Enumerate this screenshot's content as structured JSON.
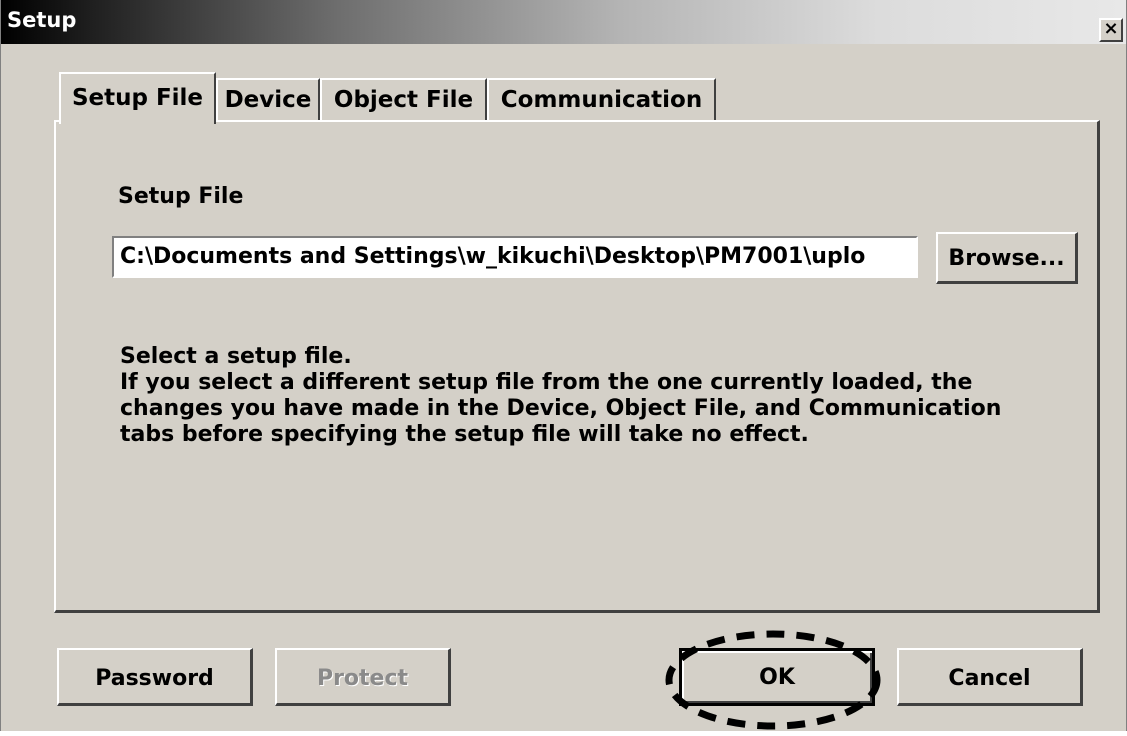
{
  "window": {
    "title": "Setup",
    "close_label": "×"
  },
  "tabs": [
    {
      "label": "Setup File",
      "active": true
    },
    {
      "label": "Device",
      "active": false
    },
    {
      "label": "Object File",
      "active": false
    },
    {
      "label": "Communication",
      "active": false
    }
  ],
  "setup_file": {
    "heading": "Setup File",
    "path_value": "C:\\Documents and Settings\\w_kikuchi\\Desktop\\PM7001\\uplo",
    "browse_label": "Browse...",
    "description": [
      "Select a setup file.",
      "If you select a different setup file from the one currently loaded, the",
      "changes you have made in the Device, Object File, and Communication",
      "tabs before specifying the setup file will take no effect."
    ]
  },
  "footer": {
    "password_label": "Password",
    "protect_label": "Protect",
    "protect_enabled": false,
    "ok_label": "OK",
    "cancel_label": "Cancel"
  },
  "colors": {
    "face": "#d4d0c8",
    "highlight_ring": "#000000"
  }
}
